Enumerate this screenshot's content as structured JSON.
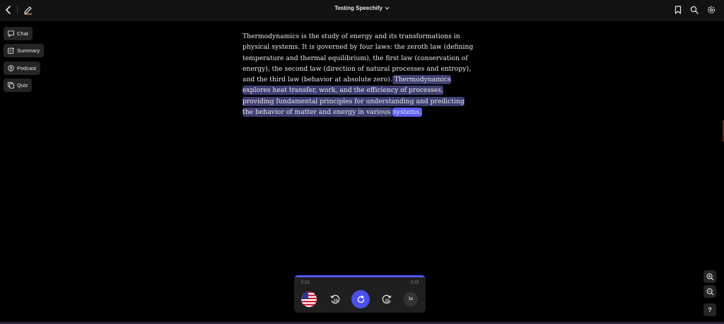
{
  "header": {
    "title": "Testing Speechify"
  },
  "sidebar": {
    "items": [
      {
        "label": "Chat",
        "icon": "chat-icon"
      },
      {
        "label": "Summary",
        "icon": "summary-icon"
      },
      {
        "label": "Podcast",
        "icon": "podcast-icon"
      },
      {
        "label": "Quiz",
        "icon": "quiz-icon"
      }
    ]
  },
  "document": {
    "text_plain": "Thermodynamics is the study of energy and its transformations in physical systems. It is governed by four laws: the zeroth law (defining temperature and thermal equilibrium), the first law (conservation of energy), the second law (direction of natural processes and entropy), and the third law (behavior at absolute zero).",
    "text_highlighted": " Thermodynamics explores heat transfer, work, and the efficiency of processes, providing fundamental principles for understanding and predicting the behavior of matter and energy in various ",
    "text_current_word": "systems."
  },
  "player": {
    "elapsed": "0:23",
    "total": "0:23",
    "progress": 1.0,
    "speed": "1x",
    "skip_back_seconds": "10",
    "skip_forward_seconds": "10",
    "voice_flag": "us-flag-icon"
  },
  "help": {
    "label": "?"
  },
  "colors": {
    "accent": "#4b50e8",
    "highlight_sentence": "#3d3f73",
    "highlight_word": "#5b5ef5",
    "background": "#000000",
    "panel": "#242424"
  }
}
